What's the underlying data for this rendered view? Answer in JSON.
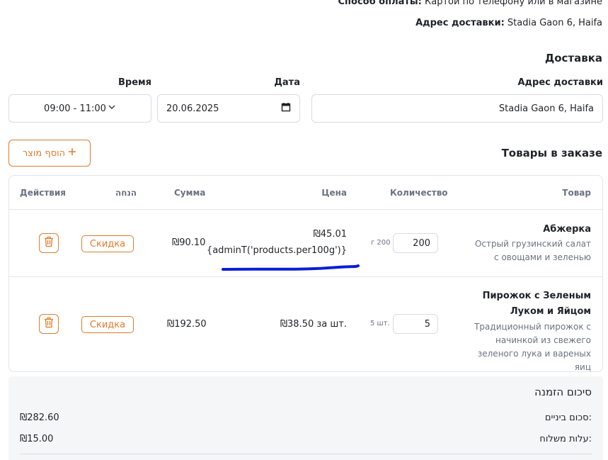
{
  "header": {
    "payment_label": "Способ оплаты:",
    "payment_value": "Картой по телефону или в магазине",
    "address_label": "Адрес доставки:",
    "address_value": "Stadia Gaon 6, Haifa"
  },
  "delivery": {
    "title": "Доставка",
    "time_label": "Время",
    "time_value": "09:00 - 11:00",
    "date_label": "Дата",
    "date_value": "20.06.2025",
    "address_label": "Адрес доставки",
    "address_value": "Stadia Gaon 6, Haifa"
  },
  "products": {
    "title": "Товары в заказе",
    "add_button": "הוסף מוצר",
    "columns": {
      "product": "Товар",
      "quantity": "Количество",
      "price": "Цена",
      "sum": "Сумма",
      "discount": "הנחה",
      "actions": "Действия"
    },
    "rows": [
      {
        "name": "Абжерка",
        "description": "Острый грузинский салат с овощами и зеленью",
        "quantity": "200",
        "unit": "г 200",
        "price": "₪45.01",
        "price_note": "{adminT('products.per100g')}",
        "sum": "₪90.10",
        "discount_button": "Скидка"
      },
      {
        "name": "Пирожок с Зеленым Луком и Яйцом",
        "description": "Традиционный пирожок с начинкой из свежего зеленого лука и вареных яиц",
        "quantity": "5",
        "unit": "5 шт.",
        "price": "₪38.50 за шт.",
        "sum": "₪192.50",
        "discount_button": "Скидка"
      }
    ]
  },
  "summary": {
    "title": "סיכום הזמנה",
    "subtotal_label": "סכום ביניים:",
    "subtotal_value": "₪282.60",
    "shipping_label": "עלות משלוח:",
    "shipping_value": "₪15.00"
  },
  "colors": {
    "accent": "#e07b2a",
    "annotation": "#0a1fd6"
  }
}
